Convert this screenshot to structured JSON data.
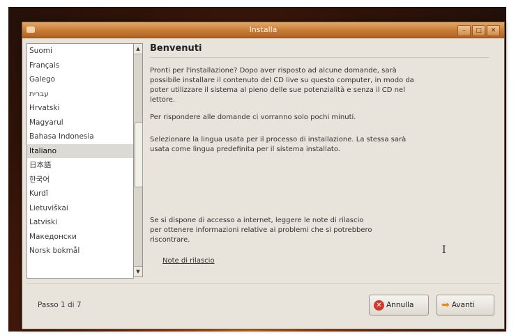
{
  "window": {
    "title": "Installa",
    "controls": [
      "minimize-icon",
      "maximize-icon",
      "close-icon"
    ]
  },
  "languages": [
    {
      "label": "Suomi",
      "selected": false
    },
    {
      "label": "Français",
      "selected": false
    },
    {
      "label": "Galego",
      "selected": false
    },
    {
      "label": "עברית",
      "selected": false
    },
    {
      "label": "Hrvatski",
      "selected": false
    },
    {
      "label": "Magyarul",
      "selected": false
    },
    {
      "label": "Bahasa Indonesia",
      "selected": false
    },
    {
      "label": "Italiano",
      "selected": true
    },
    {
      "label": "日本語",
      "selected": false
    },
    {
      "label": "한국어",
      "selected": false
    },
    {
      "label": "Kurdî",
      "selected": false
    },
    {
      "label": "Lietuviškai",
      "selected": false
    },
    {
      "label": "Latviski",
      "selected": false
    },
    {
      "label": "Македонски",
      "selected": false
    },
    {
      "label": "Norsk bokmål",
      "selected": false
    }
  ],
  "content": {
    "heading": "Benvenuti",
    "paragraph1": "Pronti per l'installazione? Dopo aver risposto ad alcune domande, sarà possibile installare il contenuto del CD live su questo computer, in modo da poter utilizzare il sistema al pieno delle sue potenzialità e senza il CD nel lettore.",
    "paragraph2": "Per rispondere alle domande ci vorranno solo pochi minuti.",
    "paragraph3": "Selezionare la lingua usata per il processo di installazione. La stessa sarà usata come lingua predefinita per il sistema installato.",
    "paragraph4": "Se si dispone di accesso a internet, leggere le note di rilascio per ottenere informazioni relative ai problemi che si potrebbero riscontrare.",
    "release_notes_link": "Note di rilascio"
  },
  "footer": {
    "step": "Passo 1 di 7",
    "cancel_label": "Annulla",
    "next_label": "Avanti"
  }
}
